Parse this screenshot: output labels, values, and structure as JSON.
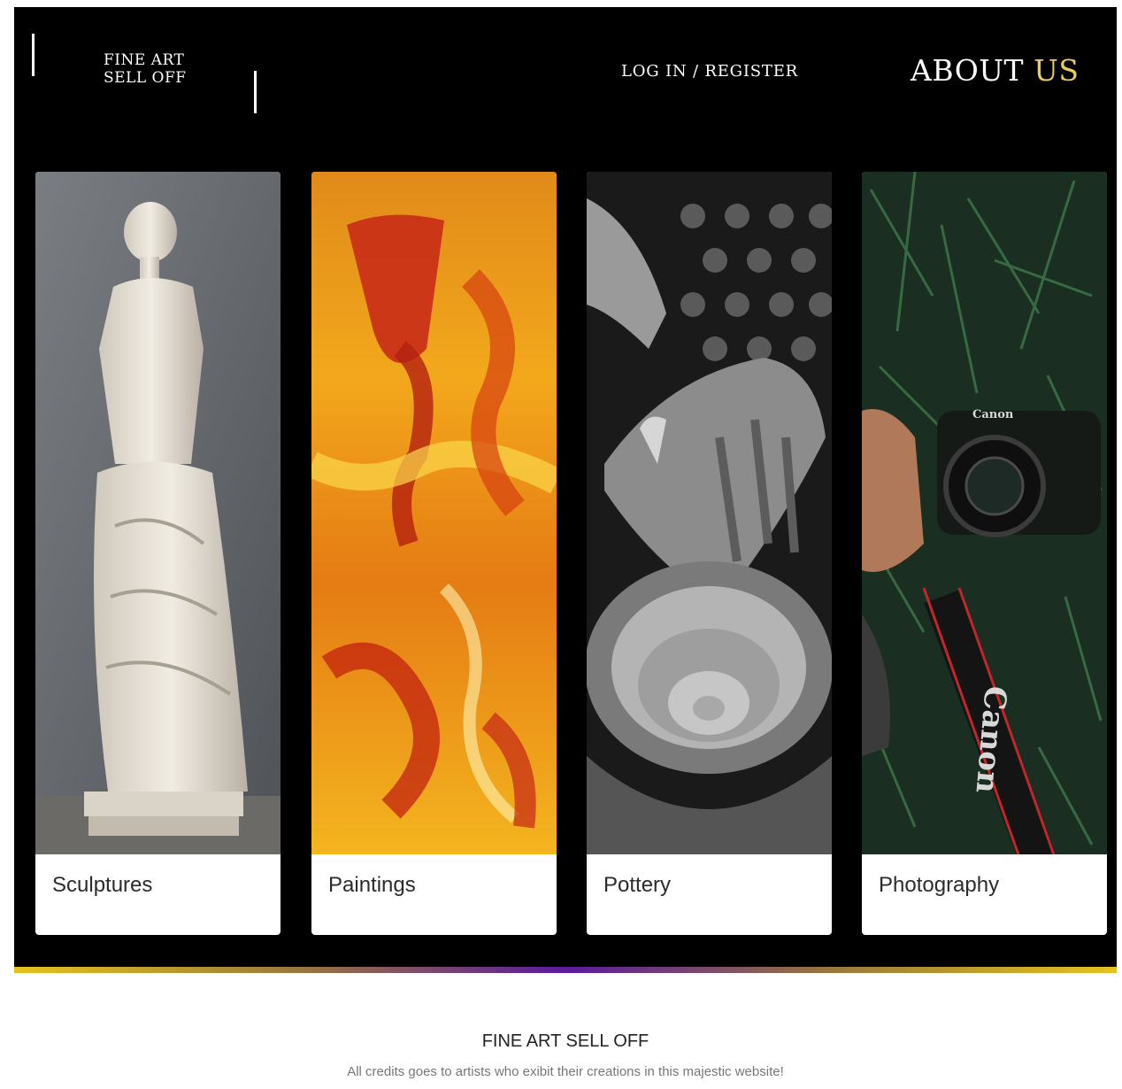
{
  "header": {
    "brand_line1": "FINE ART",
    "brand_line2": "SELL OFF",
    "login_label": "LOG IN / REGISTER",
    "about_prefix": "ABOUT",
    "about_accent": "US"
  },
  "colors": {
    "background": "#000000",
    "accent": "#e8cd61",
    "card_bg": "#ffffff"
  },
  "categories": [
    {
      "label": "Sculptures",
      "image": "sculpture-image"
    },
    {
      "label": "Paintings",
      "image": "painting-image"
    },
    {
      "label": "Pottery",
      "image": "pottery-image"
    },
    {
      "label": "Photography",
      "image": "photography-image"
    }
  ],
  "footer": {
    "title": "FINE ART SELL OFF",
    "credit": "All credits goes to artists who exibit their creations in this majestic website!"
  }
}
